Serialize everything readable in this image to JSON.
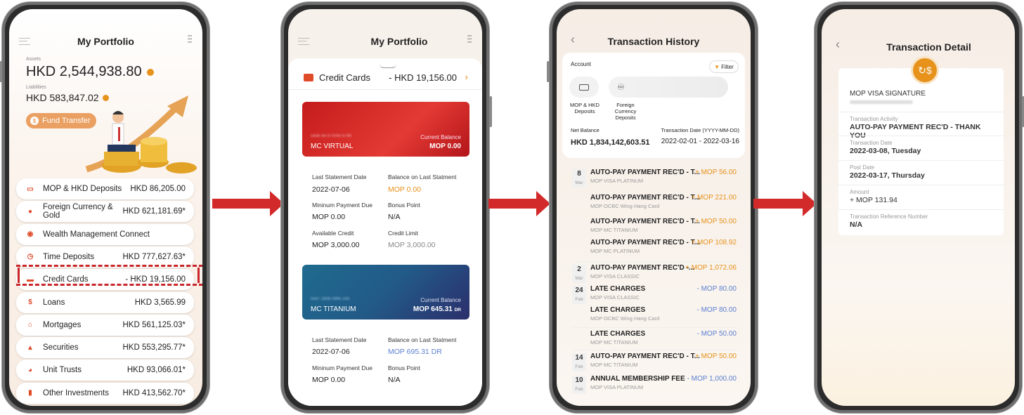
{
  "colors": {
    "accent": "#e6921b",
    "arrow": "#d22a2a",
    "negative_blue": "#5a7fd0"
  },
  "screen1": {
    "title": "My Portfolio",
    "assets_label": "Assets",
    "assets_value": "HKD 2,544,938.80",
    "liabilities_label": "Liabilities",
    "liabilities_value": "HKD 583,847.02",
    "fund_transfer": "Fund Transfer",
    "rows": [
      {
        "icon": "cash-icon",
        "label": "MOP & HKD Deposits",
        "value": "HKD 86,205.00"
      },
      {
        "icon": "currency-gold-icon",
        "label": "Foreign Currency & Gold",
        "value": "HKD 621,181.69*"
      },
      {
        "icon": "wealth-icon",
        "label": "Wealth Management Connect",
        "value": ""
      },
      {
        "icon": "time-deposit-icon",
        "label": "Time Deposits",
        "value": "HKD 777,627.63*"
      },
      {
        "icon": "credit-card-icon",
        "label": "Credit Cards",
        "value": "- HKD 19,156.00"
      },
      {
        "icon": "money-bag-icon",
        "label": "Loans",
        "value": "HKD 3,565.99"
      },
      {
        "icon": "house-icon",
        "label": "Mortgages",
        "value": "HKD 561,125.03*"
      },
      {
        "icon": "securities-icon",
        "label": "Securities",
        "value": "HKD 553,295.77*"
      },
      {
        "icon": "pie-icon",
        "label": "Unit Trusts",
        "value": "HKD 93,066.01*"
      },
      {
        "icon": "bar-chart-icon",
        "label": "Other Investments",
        "value": "HKD 413,562.70*"
      }
    ]
  },
  "screen2": {
    "title": "My Portfolio",
    "section_label": "Credit Cards",
    "section_value": "- HKD 19,156.00",
    "card1": {
      "number": "5436 5670 0000 6790",
      "name": "MC VIRTUAL",
      "balance_label": "Current Balance",
      "balance": "MOP 0.00",
      "last_stmt_label": "Last Statement Date",
      "last_stmt": "2022-07-06",
      "bal_last_label": "Balance on Last Statment",
      "bal_last": "MOP 0.00",
      "min_label": "Mininum Payment Due",
      "min": "MOP 0.00",
      "bonus_label": "Bonus Point",
      "bonus": "N/A",
      "avail_label": "Available Credit",
      "avail": "MOP 3,000.00",
      "limit_label": "Credit Limit",
      "limit": "MOP 3,000.00"
    },
    "card2": {
      "number": "5547 2808 0995 193",
      "name": "MC TITANIUM",
      "balance_label": "Current Balance",
      "balance": "MOP 645.31",
      "dr": "DR",
      "last_stmt_label": "Last Statement Date",
      "last_stmt": "2022-07-06",
      "bal_last_label": "Balance on Last Statment",
      "bal_last": "MOP 695.31 DR",
      "min_label": "Mininum Payment Due",
      "min": "MOP 0.00",
      "bonus_label": "Bonus Point",
      "bonus": "N/A"
    }
  },
  "screen3": {
    "title": "Transaction History",
    "account_label": "Account",
    "filter": "Filter",
    "acc1": "MOP & HKD Deposits",
    "acc2": "Foreign Currency Deposits",
    "net_balance_label": "Net Balance",
    "net_balance": "HKD 1,834,142,603.51",
    "date_label": "Transaction Date (YYYY-MM-DD)",
    "date_range": "2022-02-01 - 2022-03-16",
    "tx": [
      {
        "day": "8",
        "mon": "Mar",
        "title": "AUTO-PAY PAYMENT REC'D - T...",
        "sub": "MOP VISA PLATINUM",
        "amt": "+ MOP 56.00",
        "pos": true
      },
      {
        "day": "",
        "mon": "",
        "title": "AUTO-PAY PAYMENT REC'D - T...",
        "sub": "MOP OCBC Wing Hang Card",
        "amt": "+ MOP 221.00",
        "pos": true
      },
      {
        "day": "",
        "mon": "",
        "title": "AUTO-PAY PAYMENT REC'D - T...",
        "sub": "MOP MC TITANIUM",
        "amt": "+ MOP 50.00",
        "pos": true
      },
      {
        "day": "",
        "mon": "",
        "title": "AUTO-PAY PAYMENT REC'D - T...",
        "sub": "MOP MC PLATINUM",
        "amt": "+ MOP 108.92",
        "pos": true
      },
      {
        "day": "2",
        "mon": "Mar",
        "title": "AUTO-PAY PAYMENT REC'D -...",
        "sub": "MOP VISA CLASSIC",
        "amt": "+ MOP 1,072.06",
        "pos": true
      },
      {
        "day": "24",
        "mon": "Feb",
        "title": "LATE CHARGES",
        "sub": "MOP VISA CLASSIC",
        "amt": "- MOP 80.00",
        "pos": false
      },
      {
        "day": "",
        "mon": "",
        "title": "LATE CHARGES",
        "sub": "MOP OCBC Wing Hang Card",
        "amt": "- MOP 80.00",
        "pos": false
      },
      {
        "day": "",
        "mon": "",
        "title": "LATE CHARGES",
        "sub": "MOP MC TITANIUM",
        "amt": "- MOP 50.00",
        "pos": false
      },
      {
        "day": "14",
        "mon": "Feb",
        "title": "AUTO-PAY PAYMENT REC'D - T...",
        "sub": "MOP MC TITANIUM",
        "amt": "+ MOP 50.00",
        "pos": true
      },
      {
        "day": "10",
        "mon": "Feb",
        "title": "ANNUAL MEMBERSHIP FEE",
        "sub": "MOP VISA PLATINUM",
        "amt": "- MOP 1,000.00",
        "pos": false
      }
    ]
  },
  "screen4": {
    "title": "Transaction Detail",
    "card_name": "MOP VISA SIGNATURE",
    "activity_label": "Transaction Activity",
    "activity": "AUTO-PAY PAYMENT REC'D - THANK YOU",
    "tx_date_label": "Transaction Date",
    "tx_date": "2022-03-08, Tuesday",
    "post_date_label": "Post Date",
    "post_date": "2022-03-17, Thursday",
    "amount_label": "Amount",
    "amount": "+ MOP 131.94",
    "ref_label": "Transaction Reference Number",
    "ref": "N/A"
  }
}
